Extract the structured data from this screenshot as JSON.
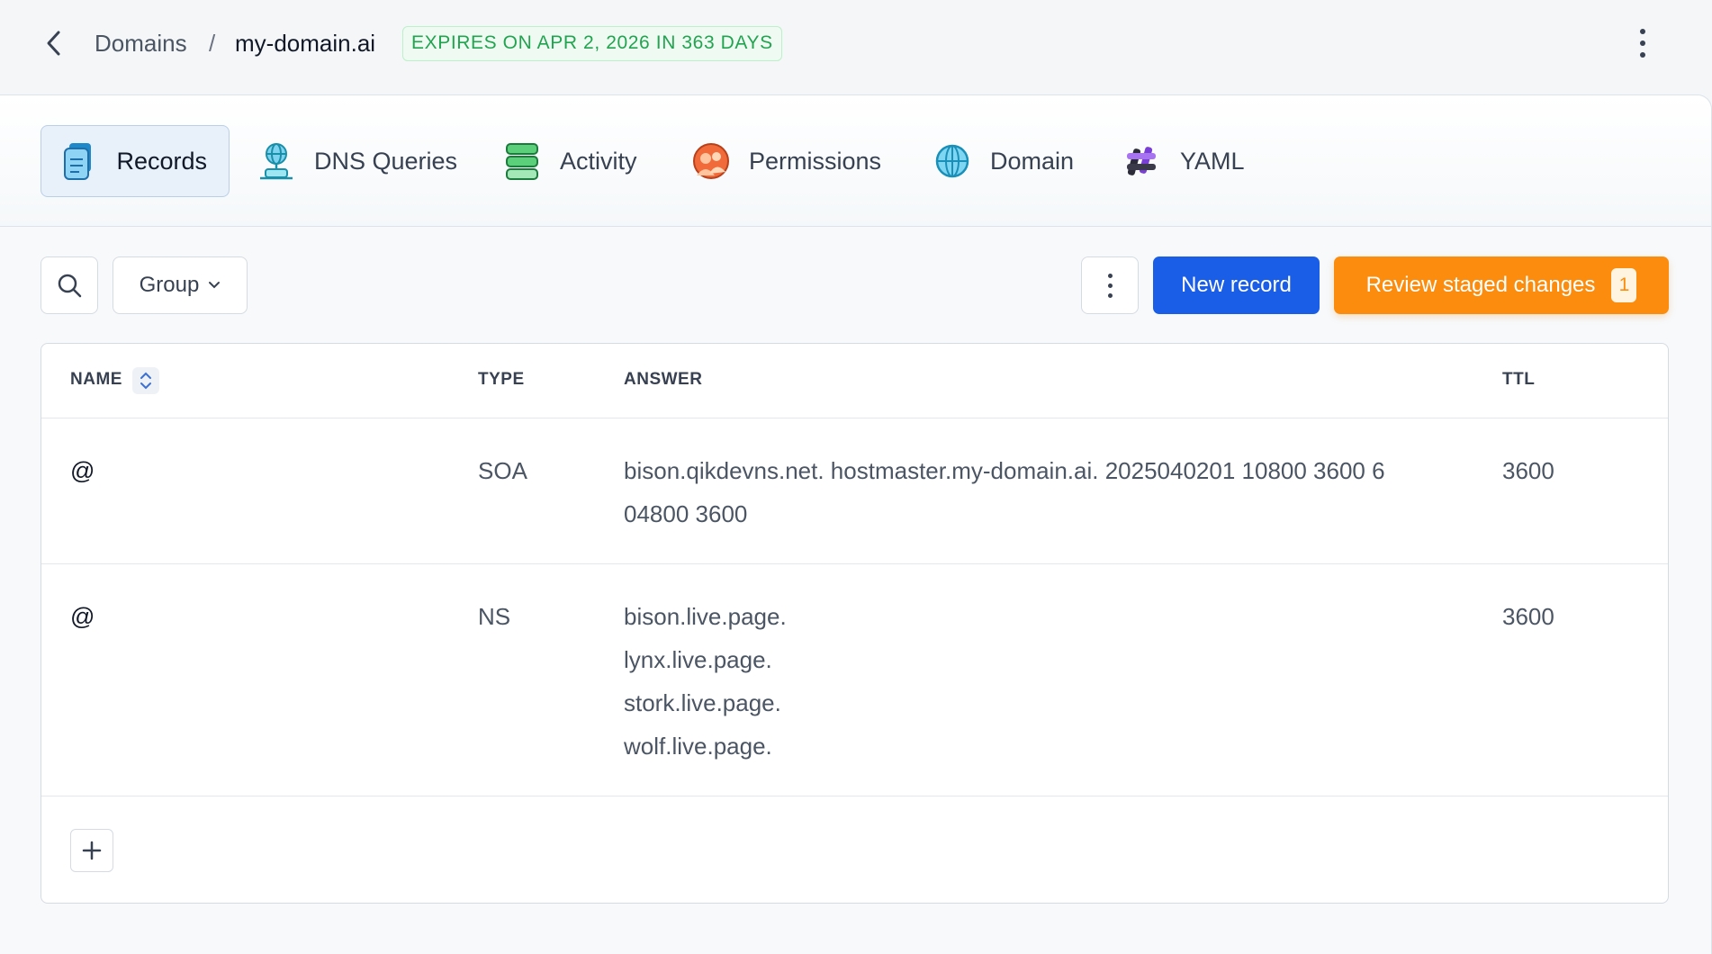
{
  "breadcrumb": {
    "parent": "Domains",
    "separator": "/",
    "current": "my-domain.ai",
    "badge": "EXPIRES ON APR 2, 2026 IN 363 DAYS"
  },
  "tabs": [
    {
      "label": "Records",
      "icon": "records-icon",
      "active": true
    },
    {
      "label": "DNS Queries",
      "icon": "dns-queries-icon",
      "active": false
    },
    {
      "label": "Activity",
      "icon": "activity-icon",
      "active": false
    },
    {
      "label": "Permissions",
      "icon": "permissions-icon",
      "active": false
    },
    {
      "label": "Domain",
      "icon": "globe-icon",
      "active": false
    },
    {
      "label": "YAML",
      "icon": "yaml-icon",
      "active": false
    }
  ],
  "toolbar": {
    "group_label": "Group",
    "new_record_label": "New record",
    "review_label": "Review staged changes",
    "review_count": "1"
  },
  "table": {
    "headers": {
      "name": "NAME",
      "type": "TYPE",
      "answer": "ANSWER",
      "ttl": "TTL"
    },
    "rows": [
      {
        "name": "@",
        "type": "SOA",
        "answer_lines": [
          "bison.qikdevns.net. hostmaster.my-domain.ai. 2025040201 10800 3600 6",
          "04800 3600"
        ],
        "ttl": "3600"
      },
      {
        "name": "@",
        "type": "NS",
        "answer_lines": [
          "bison.live.page.",
          "lynx.live.page.",
          "stork.live.page.",
          "wolf.live.page."
        ],
        "ttl": "3600"
      }
    ]
  },
  "colors": {
    "primary": "#1a5ee8",
    "warning": "#fb8c0e",
    "success": "#22a350"
  }
}
